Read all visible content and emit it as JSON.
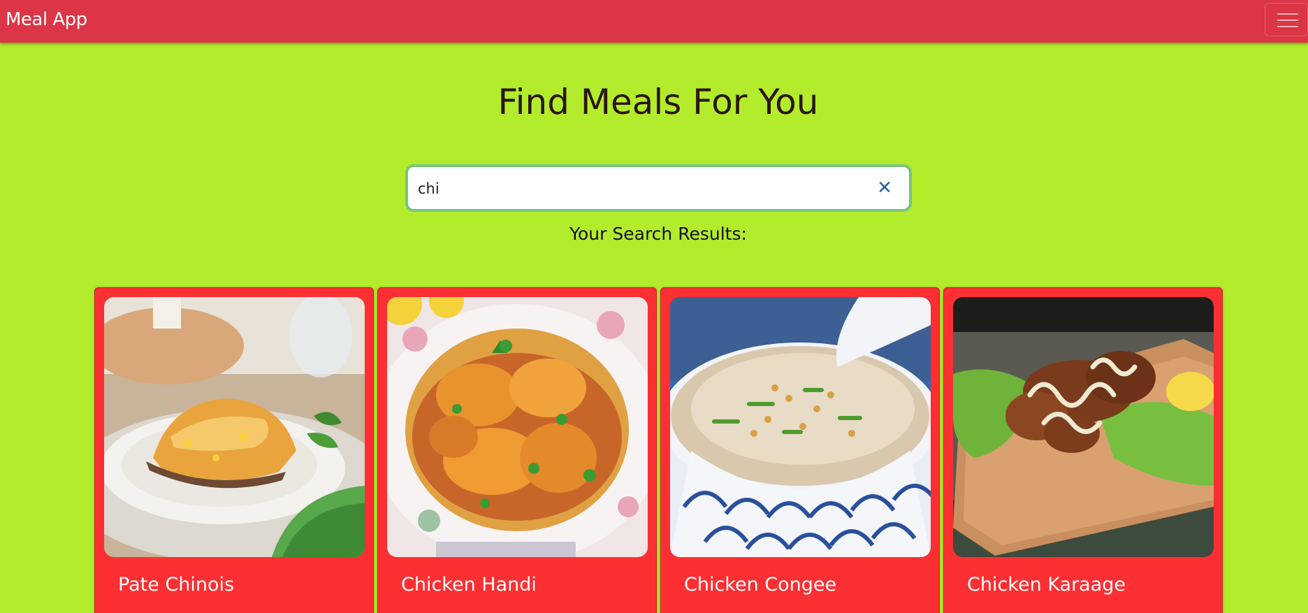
{
  "navbar": {
    "brand": "Meal App",
    "menu_icon": "hamburger-menu-icon",
    "color": "#dc3545"
  },
  "hero": {
    "title": "Find Meals For You"
  },
  "search": {
    "value": "chi",
    "clear_icon": "close-icon",
    "results_label": "Your Search Results:"
  },
  "theme": {
    "background": "#b3ec2c",
    "card_color": "#fc2f32",
    "search_border": "#78c57d"
  },
  "meals": [
    {
      "name": "Pate Chinois",
      "image": "meal-photo-pate-chinois"
    },
    {
      "name": "Chicken Handi",
      "image": "meal-photo-chicken-handi"
    },
    {
      "name": "Chicken Congee",
      "image": "meal-photo-chicken-congee"
    },
    {
      "name": "Chicken Karaage",
      "image": "meal-photo-chicken-karaage"
    }
  ]
}
